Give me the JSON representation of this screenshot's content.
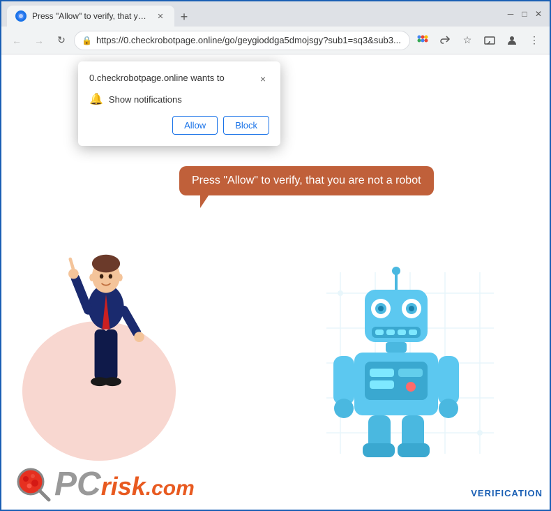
{
  "browser": {
    "tab_title": "Press \"Allow\" to verify, that you a...",
    "tab_favicon": "●",
    "url": "https://0.checkrobotpage.online/go/geygioddga5dmojsgy?sub1=sq3&sub3...",
    "new_tab_label": "+",
    "back_tooltip": "Back",
    "forward_tooltip": "Forward",
    "refresh_tooltip": "Refresh"
  },
  "notification_popup": {
    "title": "0.checkrobotpage.online wants to",
    "close_label": "×",
    "notification_text": "Show notifications",
    "allow_label": "Allow",
    "block_label": "Block"
  },
  "page": {
    "speech_text": "Press \"Allow\" to verify, that you are not a robot"
  },
  "footer": {
    "logo_pc": "PC",
    "logo_risk": "risk",
    "logo_dot_com": ".com",
    "verification": "VERIFICATION"
  },
  "colors": {
    "browser_border": "#1a5fb4",
    "speech_bg": "#c0603a",
    "allow_color": "#1a73e8",
    "block_color": "#1a73e8",
    "robot_blue": "#4ab8e0",
    "verification_color": "#1a5fb4"
  }
}
